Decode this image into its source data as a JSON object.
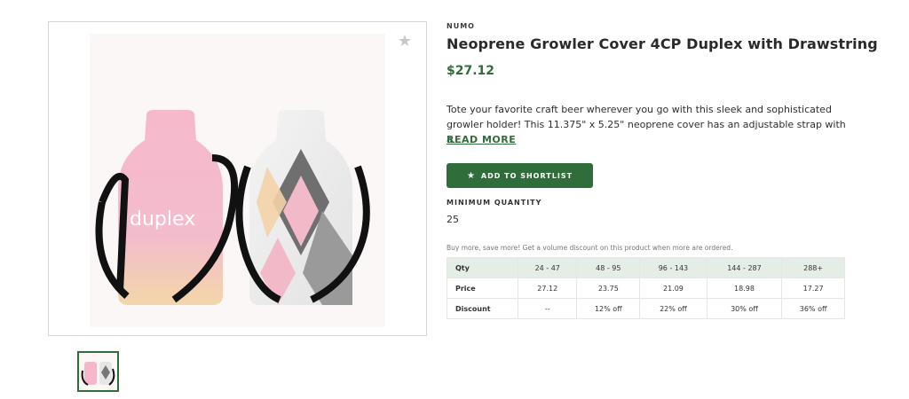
{
  "product": {
    "brand": "NUMO",
    "title": "Neoprene Growler Cover 4CP Duplex with Drawstring",
    "price": "$27.12",
    "description": "Tote your favorite craft beer wherever you go with this sleek and sophisticated growler holder! This 11.375\" x 5.25\" neoprene cover has an adjustable strap with a...",
    "read_more_label": "READ MORE",
    "shortlist_label": "ADD TO SHORTLIST",
    "min_qty_label": "MINIMUM QUANTITY",
    "min_qty_value": "25",
    "volume_note": "Buy more, save more! Get a volume discount on this product when more are ordered.",
    "image_brand_text": "duplex",
    "icons": {
      "favorite": "star-icon",
      "shortlist": "star-icon"
    }
  },
  "pricing_table": {
    "header": [
      "Qty",
      "24 - 47",
      "48 - 95",
      "96 - 143",
      "144 - 287",
      "288+"
    ],
    "rows": [
      [
        "Price",
        "27.12",
        "23.75",
        "21.09",
        "18.98",
        "17.27"
      ],
      [
        "Discount",
        "--",
        "12% off",
        "22% off",
        "30% off",
        "36% off"
      ]
    ]
  },
  "colors": {
    "accent": "#2f6e3b",
    "table_header_bg": "#e5ede7"
  }
}
